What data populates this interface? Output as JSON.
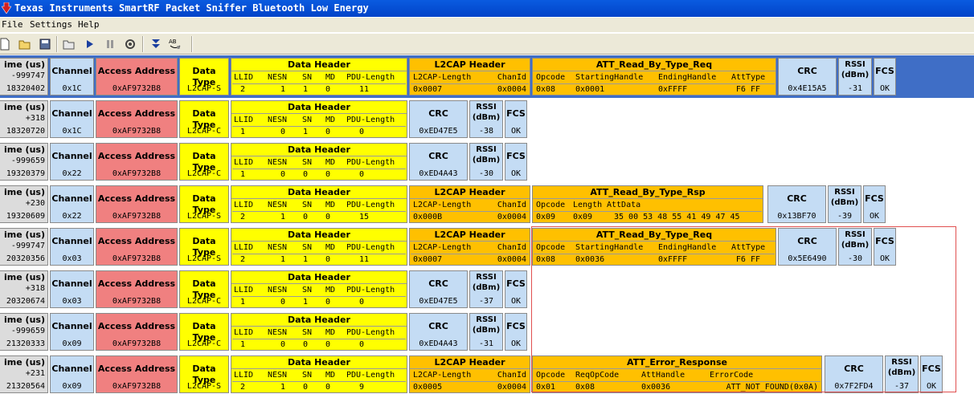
{
  "window": {
    "title": "Texas Instruments SmartRF Packet Sniffer Bluetooth Low Energy"
  },
  "menu": [
    "File",
    "Settings",
    "Help"
  ],
  "toolbar": {
    "icons": [
      "new-file-icon",
      "open-folder-icon",
      "save-icon",
      "clear-icon",
      "play-icon",
      "pause-icon",
      "settings-icon",
      "scroll-down-icon",
      "ab-display-icon"
    ]
  },
  "headers": {
    "time": "ime (us)",
    "channel": "Channel",
    "access_address": "Access Address",
    "data_type": "Data Type",
    "data_header": "Data Header",
    "l2cap_header": "L2CAP Header",
    "crc": "CRC",
    "rssi": "RSSI (dBm)",
    "fcs": "FCS",
    "dh_fields": [
      "LLID",
      "NESN",
      "SN",
      "MD",
      "PDU-Length"
    ],
    "l2_fields": [
      "L2CAP-Length",
      "ChanId"
    ]
  },
  "packets": [
    {
      "delta": "-999747",
      "time": "18320402",
      "channel": "0x1C",
      "aa": "0xAF9732B8",
      "type": "L2CAP-S",
      "llid": "2",
      "nesn": "1",
      "sn": "1",
      "md": "0",
      "pdulen": "11",
      "l2len": "0x0007",
      "chanid": "0x0004",
      "att": {
        "title": "ATT_Read_By_Type_Req",
        "fields": [
          "Opcode",
          "StartingHandle",
          "EndingHandle",
          "AttType"
        ],
        "values": [
          "0x08",
          "0x0001",
          "0xFFFF",
          "F6 FF"
        ]
      },
      "crc": "0x4E15A5",
      "rssi": "-31",
      "fcs": "OK"
    },
    {
      "delta": "+318",
      "time": "18320720",
      "channel": "0x1C",
      "aa": "0xAF9732B8",
      "type": "L2CAP-C",
      "llid": "1",
      "nesn": "0",
      "sn": "1",
      "md": "0",
      "pdulen": "0",
      "crc": "0xED47E5",
      "rssi": "-38",
      "fcs": "OK"
    },
    {
      "delta": "-999659",
      "time": "19320379",
      "channel": "0x22",
      "aa": "0xAF9732B8",
      "type": "L2CAP-C",
      "llid": "1",
      "nesn": "0",
      "sn": "0",
      "md": "0",
      "pdulen": "0",
      "crc": "0xED4A43",
      "rssi": "-30",
      "fcs": "OK"
    },
    {
      "delta": "+230",
      "time": "19320609",
      "channel": "0x22",
      "aa": "0xAF9732B8",
      "type": "L2CAP-S",
      "llid": "2",
      "nesn": "1",
      "sn": "0",
      "md": "0",
      "pdulen": "15",
      "l2len": "0x000B",
      "chanid": "0x0004",
      "att": {
        "title": "ATT_Read_By_Type_Rsp",
        "fields": [
          "Opcode",
          "Length",
          "AttData"
        ],
        "values": [
          "0x09",
          "0x09",
          "35 00 53 48 55 41 49 47 45"
        ]
      },
      "crc": "0x13BF70",
      "rssi": "-39",
      "fcs": "OK"
    },
    {
      "delta": "-999747",
      "time": "20320356",
      "channel": "0x03",
      "aa": "0xAF9732B8",
      "type": "L2CAP-S",
      "llid": "2",
      "nesn": "1",
      "sn": "1",
      "md": "0",
      "pdulen": "11",
      "l2len": "0x0007",
      "chanid": "0x0004",
      "att": {
        "title": "ATT_Read_By_Type_Req",
        "fields": [
          "Opcode",
          "StartingHandle",
          "EndingHandle",
          "AttType"
        ],
        "values": [
          "0x08",
          "0x0036",
          "0xFFFF",
          "F6 FF"
        ]
      },
      "crc": "0x5E6490",
      "rssi": "-30",
      "fcs": "OK"
    },
    {
      "delta": "+318",
      "time": "20320674",
      "channel": "0x03",
      "aa": "0xAF9732B8",
      "type": "L2CAP-C",
      "llid": "1",
      "nesn": "0",
      "sn": "1",
      "md": "0",
      "pdulen": "0",
      "crc": "0xED47E5",
      "rssi": "-37",
      "fcs": "OK"
    },
    {
      "delta": "-999659",
      "time": "21320333",
      "channel": "0x09",
      "aa": "0xAF9732B8",
      "type": "L2CAP-C",
      "llid": "1",
      "nesn": "0",
      "sn": "0",
      "md": "0",
      "pdulen": "0",
      "crc": "0xED4A43",
      "rssi": "-31",
      "fcs": "OK"
    },
    {
      "delta": "+231",
      "time": "21320564",
      "channel": "0x09",
      "aa": "0xAF9732B8",
      "type": "L2CAP-S",
      "llid": "2",
      "nesn": "1",
      "sn": "0",
      "md": "0",
      "pdulen": "9",
      "l2len": "0x0005",
      "chanid": "0x0004",
      "att": {
        "title": "ATT_Error_Response",
        "fields": [
          "Opcode",
          "ReqOpCode",
          "AttHandle",
          "ErrorCode"
        ],
        "values": [
          "0x01",
          "0x08",
          "0x0036",
          "ATT_NOT_FOUND(0x0A)"
        ]
      },
      "crc": "0x7F2FD4",
      "rssi": "-37",
      "fcs": "OK"
    }
  ]
}
